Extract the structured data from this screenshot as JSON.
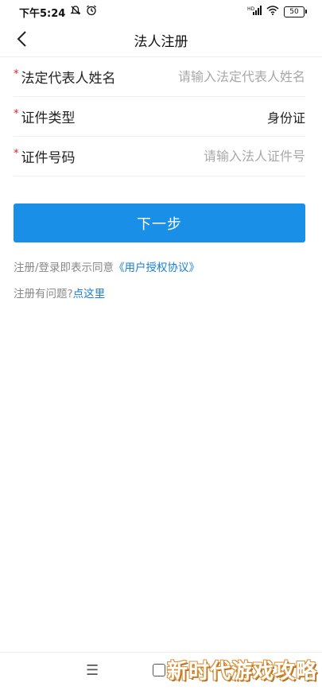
{
  "status_bar": {
    "time": "下午5:24",
    "signal": "HD",
    "battery": "50",
    "icons": [
      "mute-icon",
      "alarm-icon",
      "signal-icon",
      "wifi-icon",
      "battery-icon"
    ]
  },
  "nav": {
    "back_icon": "chevron-left-icon",
    "title": "法人注册"
  },
  "form": {
    "required_mark": "*",
    "rep_name_label": "法定代表人姓名",
    "rep_name_placeholder": "请输入法定代表人姓名",
    "id_type_label": "证件类型",
    "id_type_value": "身份证",
    "id_number_label": "证件号码",
    "id_number_placeholder": "请输入法人证件号"
  },
  "next_button": {
    "label": "下一步"
  },
  "agreement": {
    "prefix": "注册/登录即表示同意",
    "link_text": "《用户授权协议》"
  },
  "help": {
    "prefix": "注册有问题?",
    "link_text": "点这里"
  },
  "bottom_nav": {
    "menu_glyph": "☰"
  },
  "watermark": "新时代游戏攻略",
  "colors": {
    "primary": "#1a8fe8",
    "link": "#1a7fd0",
    "required": "#e02020",
    "placeholder": "#a8a8a8"
  }
}
